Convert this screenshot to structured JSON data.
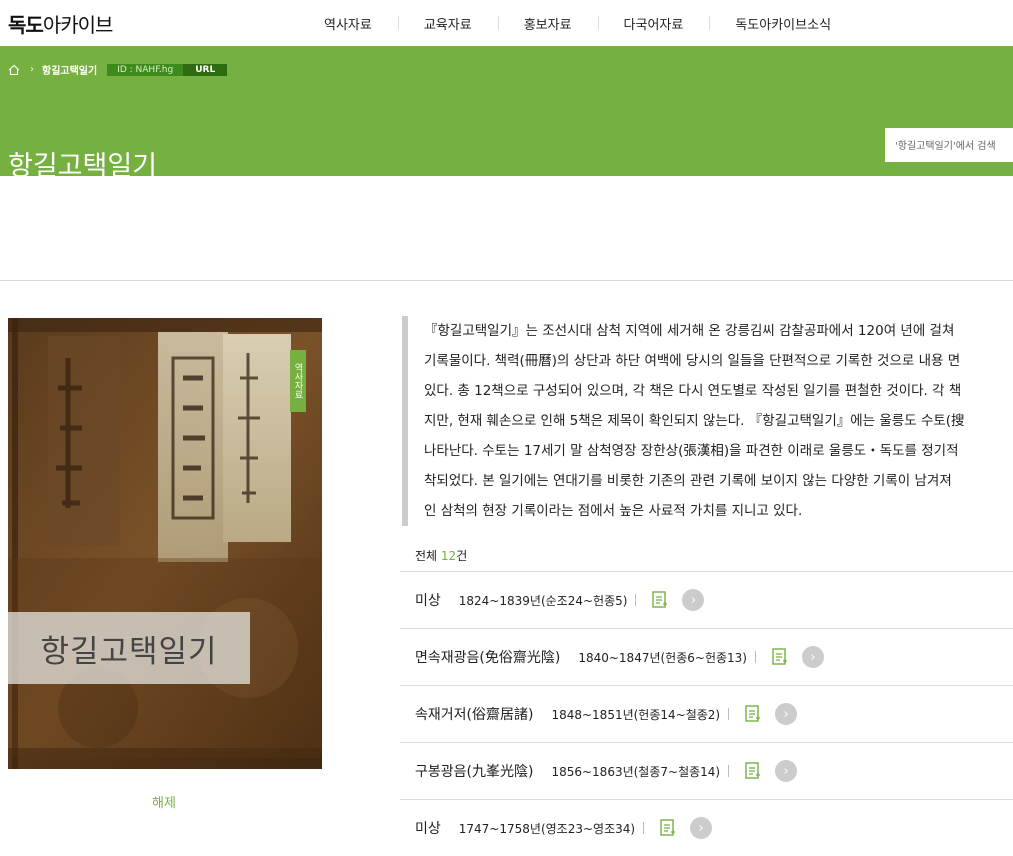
{
  "header": {
    "logo_bold": "독도",
    "logo_rest": "아카이브",
    "nav": [
      "역사자료",
      "교육자료",
      "홍보자료",
      "다국어자료",
      "독도아카이브소식"
    ]
  },
  "banner": {
    "breadcrumb": "항길고택일기",
    "id_tag": "ID : NAHF.hg",
    "url_tag": "URL",
    "title": "항길고택일기",
    "search_placeholder": "'항길고택일기'에서 검색"
  },
  "cover": {
    "title": "항길고택일기",
    "side_tab": "역사자료",
    "caption": "해제"
  },
  "description": [
    "『항길고택일기』는 조선시대 삼척 지역에 세거해 온 강릉김씨 감찰공파에서 120여 년에 걸쳐",
    "기록물이다. 책력(冊曆)의 상단과 하단 여백에 당시의 일들을 단편적으로 기록한 것으로 내용 면",
    "있다. 총 12책으로 구성되어 있으며, 각 책은 다시 연도별로 작성된 일기를 편철한 것이다. 각 책",
    "지만, 현재 훼손으로 인해 5책은 제목이 확인되지 않는다. 『항길고택일기』에는 울릉도 수토(搜",
    "나타난다. 수토는 17세기 말 삼척영장 장한상(張漢相)을 파견한 이래로 울릉도・독도를 정기적",
    "착되었다. 본 일기에는 연대기를 비롯한 기존의 관련 기록에 보이지 않는 다양한 기록이 남겨져",
    "인 삼척의 현장 기록이라는 점에서 높은 사료적 가치를 지니고 있다."
  ],
  "list": {
    "total_label": "전체",
    "total_count": "12",
    "total_unit": "건",
    "items": [
      {
        "title": "미상",
        "dates": "1824~1839년(순조24~헌종5)"
      },
      {
        "title": "면속재광음(免俗齋光陰)",
        "dates": "1840~1847년(헌종6~헌종13)"
      },
      {
        "title": "속재거저(俗齋居諸)",
        "dates": "1848~1851년(헌종14~철종2)"
      },
      {
        "title": "구봉광음(九峯光陰)",
        "dates": "1856~1863년(철종7~철종14)"
      },
      {
        "title": "미상",
        "dates": "1747~1758년(영조23~영조34)"
      }
    ]
  },
  "colors": {
    "accent": "#76b041"
  }
}
